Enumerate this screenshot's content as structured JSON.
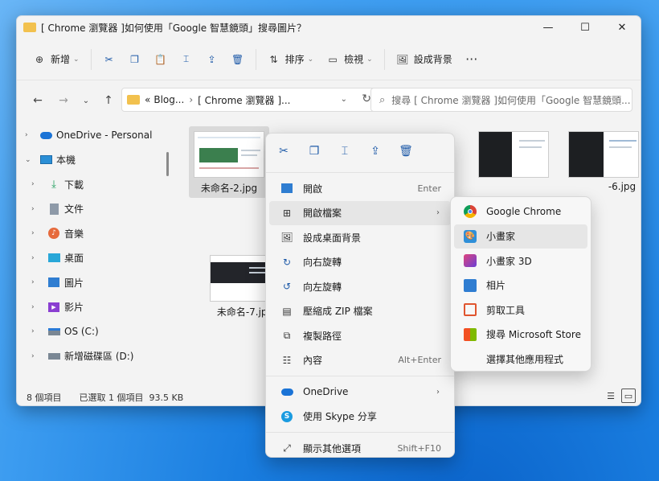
{
  "window": {
    "title": "[ Chrome 瀏覽器 ]如何使用「Google 智慧鏡頭」搜尋圖片？"
  },
  "toolbar": {
    "new_label": "新增",
    "sort_label": "排序",
    "view_label": "檢視",
    "background_label": "設成背景"
  },
  "address": {
    "prefix": "«",
    "seg1": "Blog...",
    "seg2": "[ Chrome 瀏覽器 ]...",
    "search_placeholder": "搜尋 [ Chrome 瀏覽器 ]如何使用「Google 智慧鏡頭..."
  },
  "sidebar": {
    "items": [
      {
        "label": "OneDrive - Personal",
        "icon": "cloud-icon"
      },
      {
        "label": "本機",
        "icon": "computer-icon"
      },
      {
        "label": "下載",
        "icon": "download-icon"
      },
      {
        "label": "文件",
        "icon": "document-icon"
      },
      {
        "label": "音樂",
        "icon": "music-icon"
      },
      {
        "label": "桌面",
        "icon": "desktop-icon"
      },
      {
        "label": "圖片",
        "icon": "pictures-icon"
      },
      {
        "label": "影片",
        "icon": "videos-icon"
      },
      {
        "label": "OS (C:)",
        "icon": "drive-os-icon"
      },
      {
        "label": "新增磁碟區 (D:)",
        "icon": "drive-icon"
      }
    ]
  },
  "files": {
    "file1": "未命名-2.jpg",
    "file2": "-6.jpg",
    "file3": "未命名-7.jpg"
  },
  "status": {
    "count": "8 個項目",
    "selected": "已選取 1 個項目",
    "size": "93.5 KB"
  },
  "context_menu": {
    "open": "開啟",
    "open_shortcut": "Enter",
    "open_with": "開啟檔案",
    "set_background": "設成桌面背景",
    "rotate_right": "向右旋轉",
    "rotate_left": "向左旋轉",
    "compress": "壓縮成 ZIP 檔案",
    "copy_path": "複製路徑",
    "properties": "內容",
    "properties_shortcut": "Alt+Enter",
    "onedrive": "OneDrive",
    "skype": "使用 Skype 分享",
    "more": "顯示其他選項",
    "more_shortcut": "Shift+F10"
  },
  "submenu": {
    "items": [
      {
        "label": "Google Chrome",
        "icon": "chrome-icon"
      },
      {
        "label": "小畫家",
        "icon": "paint-icon"
      },
      {
        "label": "小畫家 3D",
        "icon": "paint3d-icon"
      },
      {
        "label": "相片",
        "icon": "photos-icon"
      },
      {
        "label": "剪取工具",
        "icon": "snipping-tool-icon"
      },
      {
        "label": "搜尋 Microsoft Store",
        "icon": "store-icon"
      },
      {
        "label": "選擇其他應用程式",
        "icon": ""
      }
    ]
  },
  "colors": {
    "accent": "#1e5aa8",
    "selection": "#d9d9d9"
  }
}
